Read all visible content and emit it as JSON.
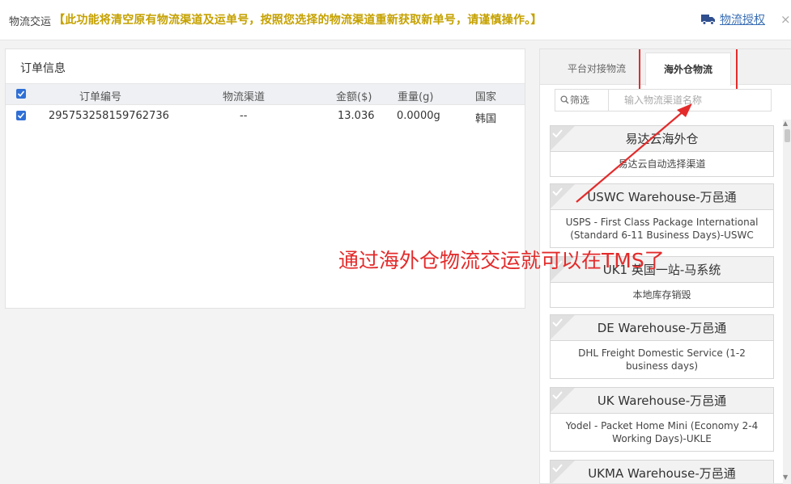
{
  "header": {
    "title": "物流交运",
    "warning": "【此功能将清空原有物流渠道及运单号，按照您选择的物流渠道重新获取新单号，请谨慎操作。】",
    "auth_link": "物流授权",
    "close": "×",
    "colors": {
      "warning": "#c5a100",
      "link": "#3a6fb5"
    }
  },
  "order_panel": {
    "title": "订单信息",
    "columns": [
      "订单编号",
      "物流渠道",
      "金额($)",
      "重量(g)",
      "国家"
    ],
    "rows": [
      {
        "order_no": "295753258159762736",
        "channel": "--",
        "amount": "13.036",
        "weight": "0.0000g",
        "country": "韩国"
      }
    ]
  },
  "logistics_panel": {
    "tabs": [
      {
        "label": "平台对接物流",
        "active": false
      },
      {
        "label": "海外仓物流",
        "active": true
      }
    ],
    "filter": {
      "button": "筛选",
      "placeholder": "输入物流渠道名称"
    },
    "cards": [
      {
        "warehouse": "易达云海外仓",
        "service": "易达云自动选择渠道"
      },
      {
        "warehouse": "USWC Warehouse-万邑通",
        "service": "USPS - First Class Package International (Standard 6-11 Business Days)-USWC"
      },
      {
        "warehouse": "UK1 英国一站-马系统",
        "service": "本地库存销毁"
      },
      {
        "warehouse": "DE Warehouse-万邑通",
        "service": "DHL Freight Domestic Service (1-2 business days)"
      },
      {
        "warehouse": "UK Warehouse-万邑通",
        "service": "Yodel - Packet Home Mini (Economy 2-4 Working Days)-UKLE"
      },
      {
        "warehouse": "UKMA Warehouse-万邑通",
        "service": ""
      }
    ]
  },
  "annotation": {
    "text": "通过海外仓物流交运就可以在TMS了",
    "color": "#e32b2b"
  }
}
